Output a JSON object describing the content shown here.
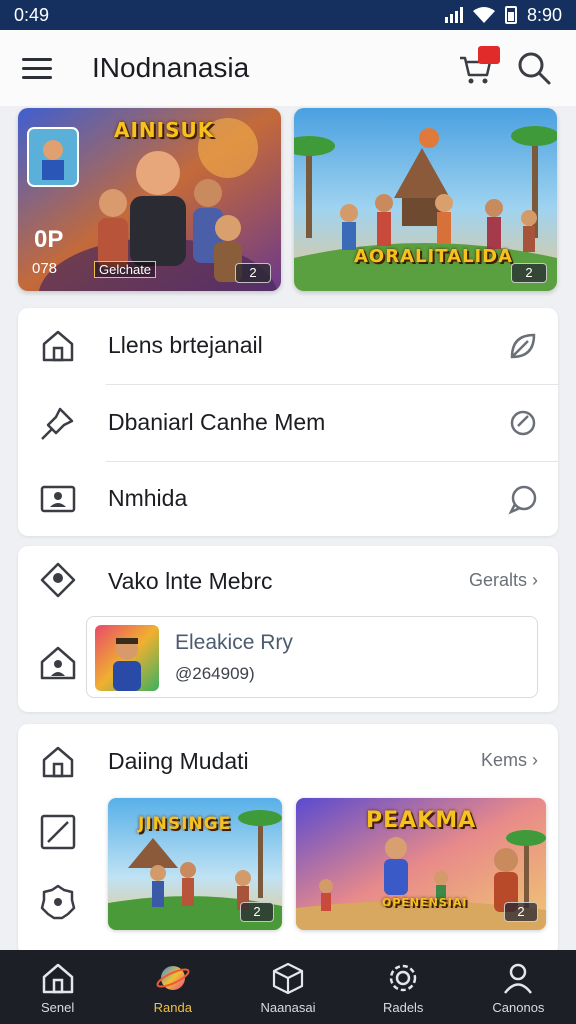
{
  "status": {
    "time": "0:49",
    "right_time": "8:90"
  },
  "appbar": {
    "title": "INodnanasia",
    "cart_badge": ""
  },
  "banners": [
    {
      "title": "AINISUK",
      "small_top": "0P",
      "small_bottom": "078",
      "caption": "Gelchate",
      "badge": "2"
    },
    {
      "title": "AORALITALIDA",
      "badge": "2"
    }
  ],
  "list1": [
    {
      "label": "Llens brtejanail",
      "icon": "home-icon",
      "right_icon": "leaf-icon"
    },
    {
      "label": "Dbaniarl Canhe Mem",
      "icon": "pin-icon",
      "right_icon": "refresh-icon"
    },
    {
      "label": "Nmhida",
      "icon": "id-card-icon",
      "right_icon": "chat-icon"
    }
  ],
  "section2": {
    "label": "Vako lnte Mebrc",
    "link": "Geralts",
    "profile_name": "Eleakice Rry",
    "profile_sub": "@264909)"
  },
  "section3": {
    "label": "Daiing Mudati",
    "link": "Kems",
    "thumbs": [
      {
        "title": "JINSINGE",
        "badge": "2"
      },
      {
        "title": "PEAKMA",
        "subtitle": "OPENENSIAI",
        "badge": "2"
      }
    ]
  },
  "bottom_nav": [
    {
      "label": "Senel",
      "icon": "home-icon"
    },
    {
      "label": "Randa",
      "icon": "planet-icon"
    },
    {
      "label": "Naanasai",
      "icon": "box-icon"
    },
    {
      "label": "Radels",
      "icon": "gear-icon"
    },
    {
      "label": "Canonos",
      "icon": "person-icon"
    }
  ]
}
